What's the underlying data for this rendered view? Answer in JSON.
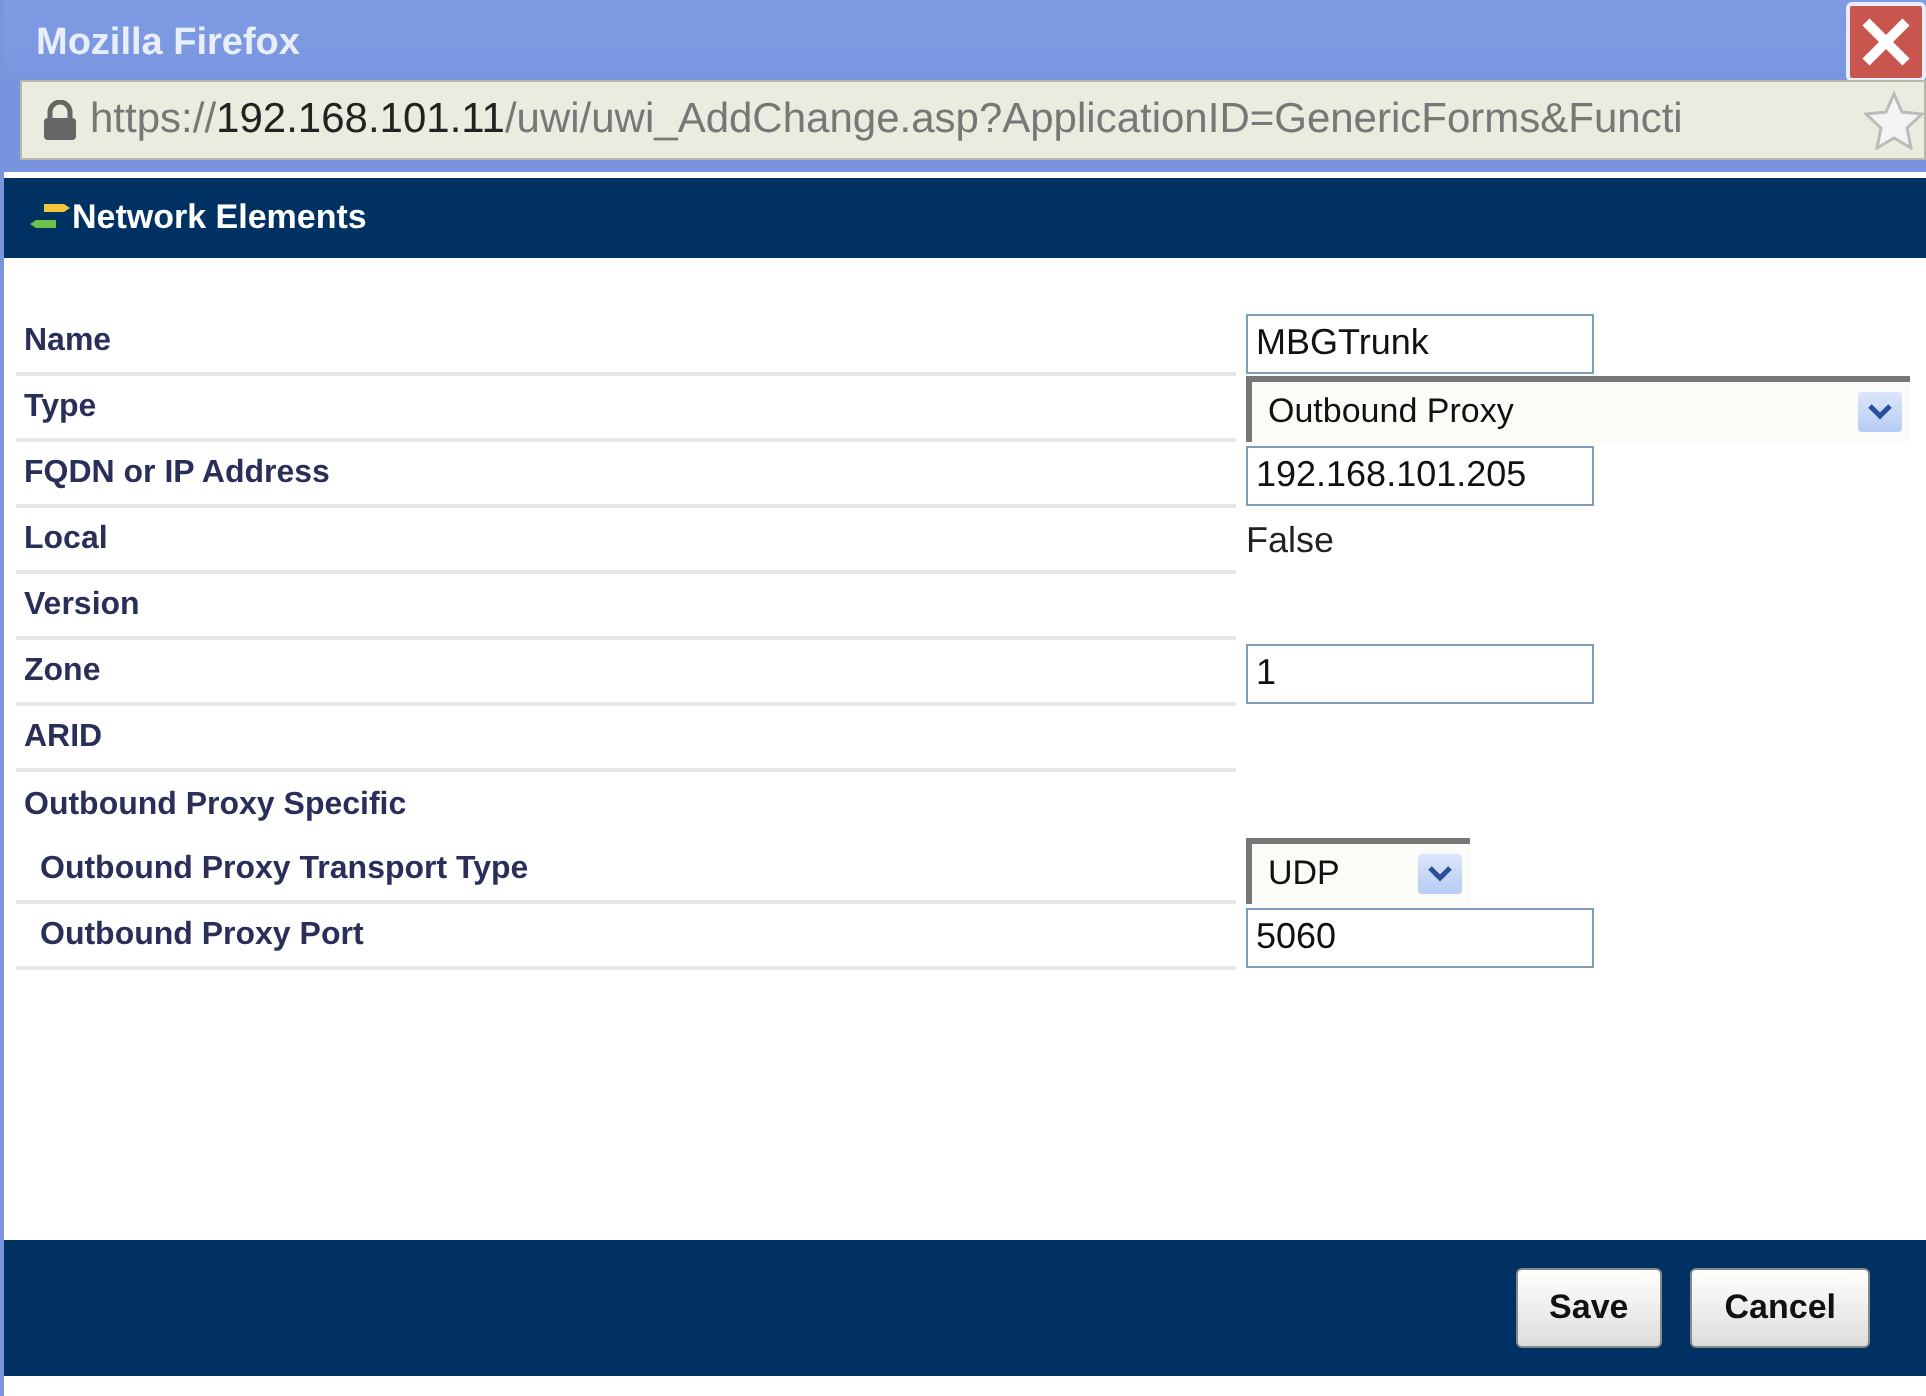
{
  "window": {
    "title": "Mozilla Firefox"
  },
  "address_bar": {
    "scheme": "https://",
    "host": "192.168.101.11",
    "path": "/uwi/uwi_AddChange.asp?ApplicationID=GenericForms&Functi"
  },
  "header": {
    "title": "Network Elements"
  },
  "rows": [
    {
      "kind": "input",
      "label": "Name",
      "value": "MBGTrunk"
    },
    {
      "kind": "select",
      "label": "Type",
      "value": "Outbound Proxy",
      "wide": true
    },
    {
      "kind": "input",
      "label": "FQDN or IP Address",
      "value": "192.168.101.205"
    },
    {
      "kind": "text",
      "label": "Local",
      "value": "False"
    },
    {
      "kind": "empty",
      "label": "Version"
    },
    {
      "kind": "input",
      "label": "Zone",
      "value": "1"
    },
    {
      "kind": "empty",
      "label": "ARID"
    },
    {
      "kind": "section",
      "label": "Outbound Proxy Specific",
      "children": [
        {
          "kind": "select",
          "label": "Outbound Proxy Transport Type",
          "value": "UDP",
          "wide": false
        },
        {
          "kind": "input",
          "label": "Outbound Proxy Port",
          "value": "5060"
        }
      ]
    }
  ],
  "buttons": [
    "Save",
    "Cancel"
  ]
}
